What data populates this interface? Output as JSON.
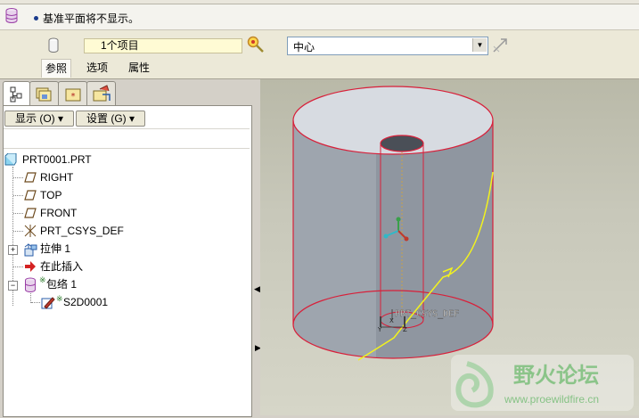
{
  "dashboard": {
    "message": "基准平面将不显示。",
    "reference_field": "1个项目",
    "combo_value": "中心",
    "tabs": [
      "参照",
      "选项",
      "属性"
    ]
  },
  "navigator": {
    "show_button": "显示 (O) ▾",
    "settings_button": "设置 (G) ▾",
    "tree": [
      {
        "label": "PRT0001.PRT",
        "icon": "part-icon"
      },
      {
        "label": "RIGHT",
        "icon": "datum-plane-icon"
      },
      {
        "label": "TOP",
        "icon": "datum-plane-icon"
      },
      {
        "label": "FRONT",
        "icon": "datum-plane-icon"
      },
      {
        "label": "PRT_CSYS_DEF",
        "icon": "csys-icon"
      },
      {
        "label": "拉伸 1",
        "icon": "extrude-icon"
      },
      {
        "label": "在此插入",
        "icon": "insert-arrow-icon"
      },
      {
        "label": "包络 1",
        "icon": "wrap-icon"
      },
      {
        "label": "S2D0001",
        "icon": "sketch-icon"
      }
    ]
  },
  "graphics": {
    "csys_label": "PRT_CSYS_DEF",
    "csys_axis_labels": [
      "Y",
      "X",
      "Z"
    ]
  },
  "watermark": {
    "title": "野火论坛",
    "url": "www.proewildfire.cn"
  },
  "colors": {
    "edge_red": "#d8203a",
    "curve_yellow": "#f2f21e",
    "cylinder_body": "#8d949e",
    "cylinder_top": "#d6dae0"
  }
}
